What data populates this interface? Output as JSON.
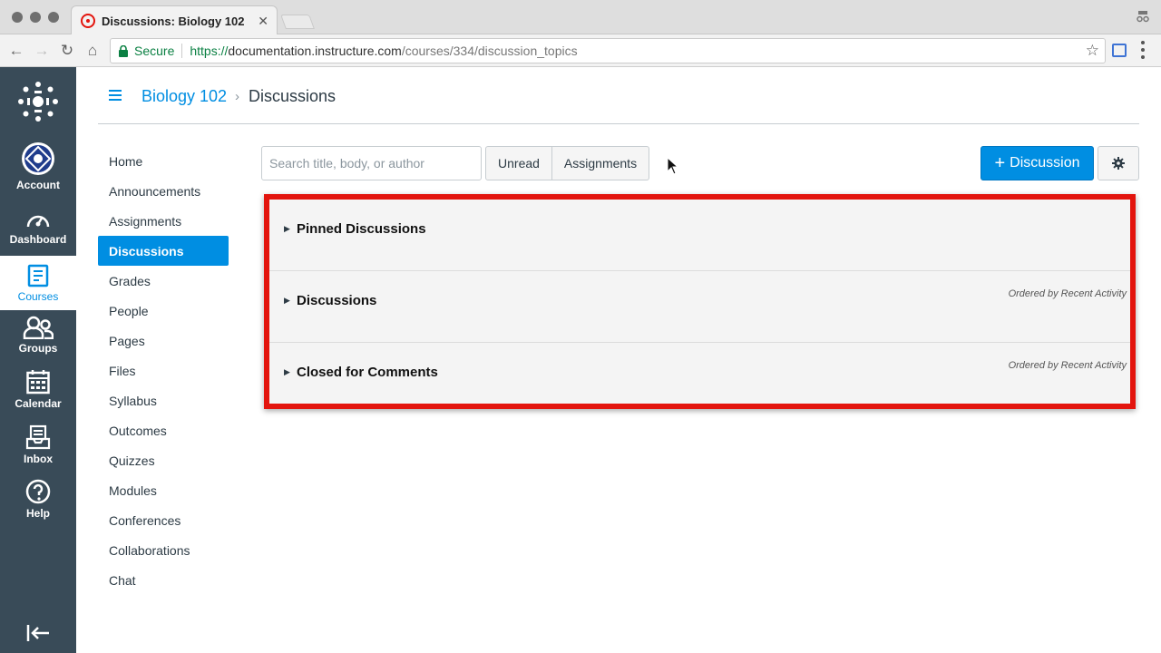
{
  "browser": {
    "tab_title": "Discussions: Biology 102",
    "tab_close": "✕",
    "secure_label": "Secure",
    "url_scheme_host_prefix": "https://",
    "url_host": "documentation.instructure.com",
    "url_path": "/courses/334/discussion_topics",
    "back_glyph": "←",
    "forward_glyph": "→",
    "reload_glyph": "↻",
    "home_glyph": "⌂",
    "star_glyph": "☆"
  },
  "global_nav": {
    "items": [
      {
        "label": "Account"
      },
      {
        "label": "Dashboard"
      },
      {
        "label": "Courses"
      },
      {
        "label": "Groups"
      },
      {
        "label": "Calendar"
      },
      {
        "label": "Inbox"
      },
      {
        "label": "Help"
      }
    ],
    "active": "Courses"
  },
  "breadcrumb": {
    "course": "Biology 102",
    "separator": "›",
    "page": "Discussions"
  },
  "course_nav": {
    "items": [
      "Home",
      "Announcements",
      "Assignments",
      "Discussions",
      "Grades",
      "People",
      "Pages",
      "Files",
      "Syllabus",
      "Outcomes",
      "Quizzes",
      "Modules",
      "Conferences",
      "Collaborations",
      "Chat"
    ],
    "active": "Discussions"
  },
  "toolbar": {
    "search_placeholder": "Search title, body, or author",
    "filter_unread": "Unread",
    "filter_assignments": "Assignments",
    "add_plus": "+",
    "add_label": "Discussion"
  },
  "groups": [
    {
      "title": "Pinned Discussions",
      "order": ""
    },
    {
      "title": "Discussions",
      "order": "Ordered by Recent Activity"
    },
    {
      "title": "Closed for Comments",
      "order": "Ordered by Recent Activity"
    }
  ],
  "colors": {
    "brand": "#008ee2",
    "nav_bg": "#394b58",
    "highlight": "#e3150e"
  }
}
